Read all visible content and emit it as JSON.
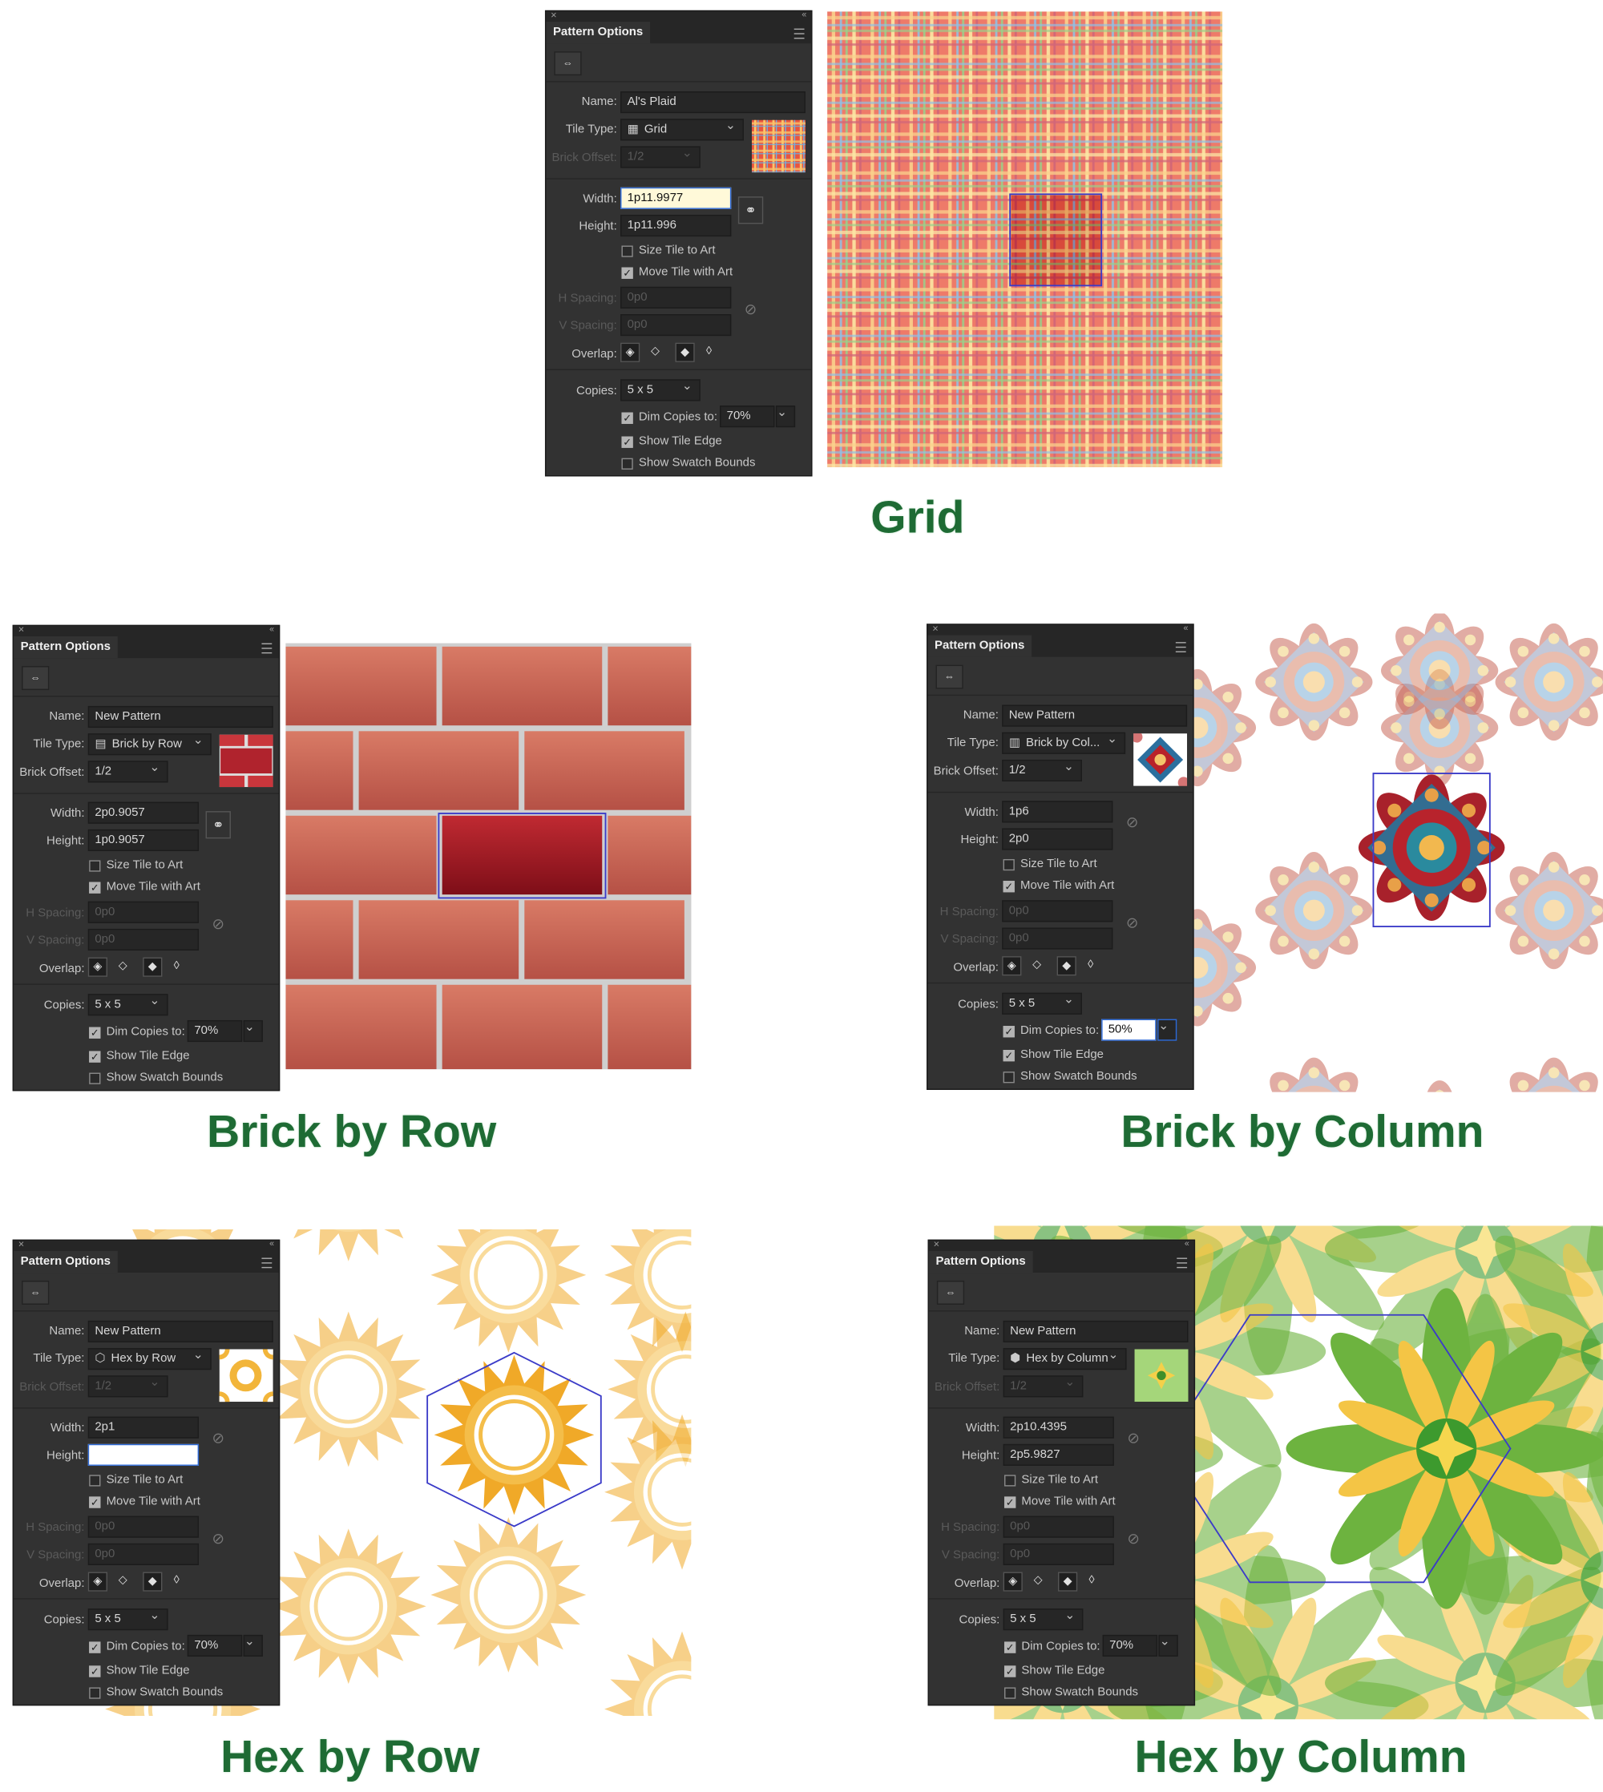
{
  "headings": {
    "grid": "Grid",
    "brick_row": "Brick by Row",
    "brick_column": "Brick by Column",
    "hex_row": "Hex by Row",
    "hex_column": "Hex by Column"
  },
  "labels": {
    "panel_title": "Pattern Options",
    "name": "Name:",
    "tile_type": "Tile Type:",
    "brick_offset": "Brick Offset:",
    "width": "Width:",
    "height": "Height:",
    "size_tile": "Size Tile to Art",
    "move_tile": "Move Tile with Art",
    "h_spacing": "H Spacing:",
    "v_spacing": "V Spacing:",
    "overlap": "Overlap:",
    "copies": "Copies:",
    "dim_copies": "Dim Copies to:",
    "show_tile_edge": "Show Tile Edge",
    "show_swatch_bounds": "Show Swatch Bounds",
    "spacing_value": "0p0"
  },
  "panels": [
    {
      "id": "grid",
      "name": "Al's Plaid",
      "tile_type": "Grid",
      "tile_icon": "grid-tile-icon",
      "brick_offset": "1/2",
      "brick_offset_enabled": false,
      "width": "1p11.9977",
      "height": "1p11.996",
      "width_active": true,
      "height_active": false,
      "linked": true,
      "size_tile": false,
      "move_tile": true,
      "copies": "5 x 5",
      "dim_copies": true,
      "dim_value": "70%",
      "dim_active": false,
      "show_tile_edge": true,
      "show_swatch_bounds": false
    },
    {
      "id": "brick_row",
      "name": "New Pattern",
      "tile_type": "Brick by Row",
      "tile_icon": "brick-row-tile-icon",
      "brick_offset": "1/2",
      "brick_offset_enabled": true,
      "width": "2p0.9057",
      "height": "1p0.9057",
      "width_active": false,
      "height_active": false,
      "linked": true,
      "size_tile": false,
      "move_tile": true,
      "copies": "5 x 5",
      "dim_copies": true,
      "dim_value": "70%",
      "dim_active": false,
      "show_tile_edge": true,
      "show_swatch_bounds": false
    },
    {
      "id": "brick_column",
      "name": "New Pattern",
      "tile_type": "Brick by Col...",
      "tile_icon": "brick-column-tile-icon",
      "brick_offset": "1/2",
      "brick_offset_enabled": true,
      "width": "1p6",
      "height": "2p0",
      "width_active": false,
      "height_active": false,
      "linked": false,
      "size_tile": false,
      "move_tile": true,
      "copies": "5 x 5",
      "dim_copies": true,
      "dim_value": "50%",
      "dim_active": true,
      "show_tile_edge": true,
      "show_swatch_bounds": false
    },
    {
      "id": "hex_row",
      "name": "New Pattern",
      "tile_type": "Hex by Row",
      "tile_icon": "hex-row-tile-icon",
      "brick_offset": "1/2",
      "brick_offset_enabled": false,
      "width": "2p1",
      "height": "",
      "width_active": false,
      "height_active": true,
      "linked": false,
      "size_tile": false,
      "move_tile": true,
      "copies": "5 x 5",
      "dim_copies": true,
      "dim_value": "70%",
      "dim_active": false,
      "show_tile_edge": true,
      "show_swatch_bounds": false
    },
    {
      "id": "hex_column",
      "name": "New Pattern",
      "tile_type": "Hex by Column",
      "tile_icon": "hex-column-tile-icon",
      "brick_offset": "1/2",
      "brick_offset_enabled": false,
      "width": "2p10.4395",
      "height": "2p5.9827",
      "width_active": false,
      "height_active": false,
      "linked": false,
      "size_tile": false,
      "move_tile": true,
      "copies": "5 x 5",
      "dim_copies": true,
      "dim_value": "70%",
      "dim_active": false,
      "show_tile_edge": true,
      "show_swatch_bounds": false
    }
  ],
  "colors": {
    "panel_bg": "#323232",
    "heading_green": "#1e6b34",
    "tile_edge": "#3b3bc8",
    "brick": "#cf6a55",
    "brick_selected": "#9e1a22",
    "mortar": "#cfcfcf",
    "plaid_base": "#e9553f",
    "sun_gold": "#f2b53a",
    "leaf_green": "#6db33f"
  }
}
